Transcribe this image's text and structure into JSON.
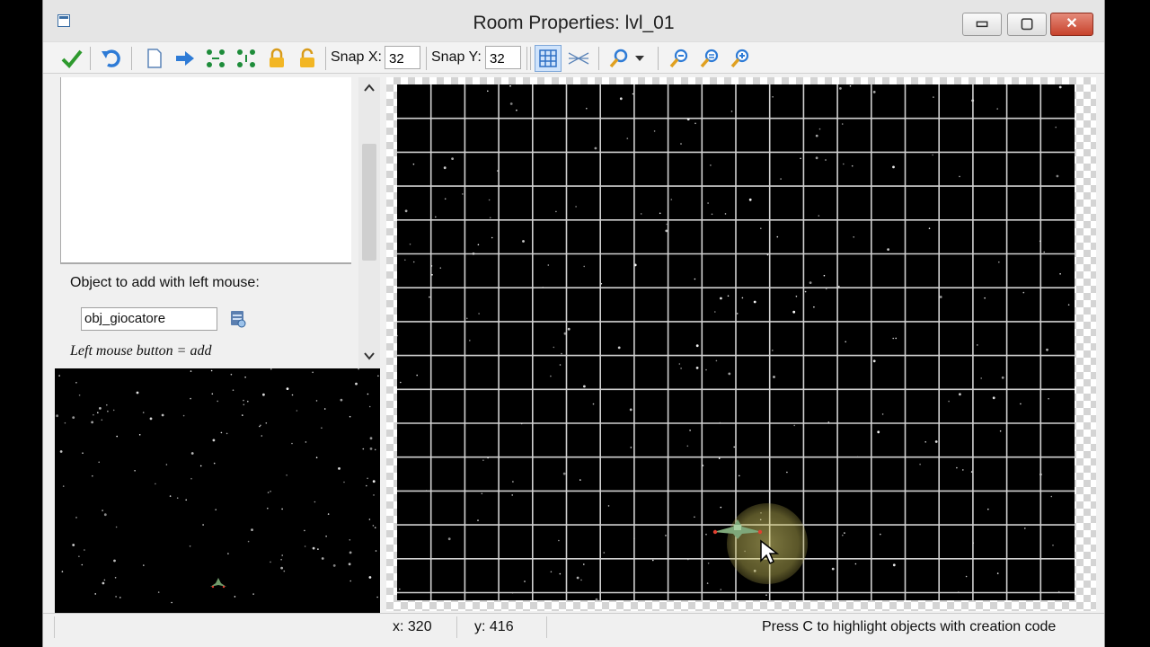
{
  "window": {
    "title": "Room Properties: lvl_01"
  },
  "title_buttons": {
    "minimize": "▭",
    "maximize": "▢",
    "close": "✕"
  },
  "toolbar": {
    "snap_x_label": "Snap X:",
    "snap_x_value": "32",
    "snap_y_label": "Snap Y:",
    "snap_y_value": "32"
  },
  "left_panel": {
    "object_label": "Object to add with left mouse:",
    "object_value": "obj_giocatore",
    "hint": "Left mouse button = add"
  },
  "status": {
    "x": "x: 320",
    "y": "y: 416",
    "message": "Press C to highlight objects with creation code"
  },
  "colors": {
    "accent": "#2e7bd6",
    "confirm": "#2e9a2e",
    "room_bg": "#000000",
    "grid": "#d0d0d0"
  },
  "icons": [
    "confirm-check-icon",
    "undo-icon",
    "clear-icon",
    "shift-right-icon",
    "spread-x-icon",
    "spread-y-icon",
    "lock-icon",
    "unlock-icon",
    "grid-icon",
    "isometric-icon",
    "magnifier-icon",
    "zoom-out-icon",
    "zoom-reset-icon",
    "zoom-in-icon"
  ]
}
